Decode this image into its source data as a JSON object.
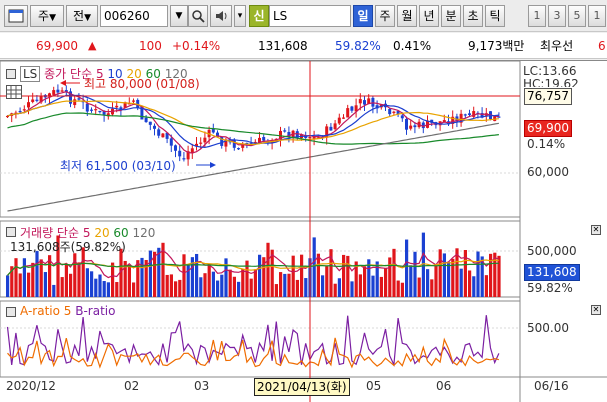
{
  "toolbar": {
    "market_select": "주",
    "market_arrow": "▼",
    "code_label": "전",
    "stock_code": "006260",
    "code_arrow": "▼",
    "shin_label": "신",
    "stock_name": "LS",
    "periods": [
      "일",
      "주",
      "월",
      "년",
      "분",
      "초",
      "틱"
    ],
    "active_period": "일",
    "interval_buttons": [
      "1",
      "3",
      "5",
      "1"
    ],
    "icons": [
      "window-icon",
      "search-icon",
      "speaker-icon",
      "dropdown-icon"
    ]
  },
  "infobar": {
    "price": "69,900",
    "change": "100",
    "change_pct": "+0.14%",
    "volume": "131,608",
    "volume_ratio": "59.82%",
    "turnover": "0.41%",
    "trading_value": "9,173백만",
    "preferred_label": "최우선",
    "preferred_value": "6"
  },
  "price_panel": {
    "series_label": "LS",
    "ma_label": "종가 단순",
    "ma_periods": [
      "5",
      "10",
      "20",
      "60",
      "120"
    ],
    "high_annotation": "최고 80,000 (01/08)",
    "low_annotation": "최저 61,500 (03/10)",
    "lc_label": "LC:13.66",
    "hc_label": "HC:19.62",
    "crosshair_value": "76,757",
    "current_price": "69,900",
    "current_change": "0.14%",
    "y_tick": "60,000"
  },
  "volume_panel": {
    "label": "거래량 단순",
    "ma_periods": [
      "5",
      "20",
      "60",
      "120"
    ],
    "info": "131,608주(59.82%)",
    "y_tick": "500,000",
    "current_volume": "131,608",
    "current_ratio": "59.82%"
  },
  "ratio_panel": {
    "a_label": "A-ratio 5",
    "b_label": "B-ratio",
    "y_tick": "500.00"
  },
  "x_axis": {
    "labels": [
      "2020/12",
      "02",
      "03",
      "05",
      "06"
    ],
    "crosshair_date": "2021/04/13(화)",
    "right_date": "06/16"
  },
  "colors": {
    "up": "#e0161b",
    "down": "#1b41d2",
    "ma5": "#c2185b",
    "ma10": "#1c3fcf",
    "ma20": "#e8a300",
    "ma60": "#198a2b",
    "ma120": "#707070",
    "a_ratio": "#ef6c00",
    "b_ratio": "#7b1fa2",
    "crosshair": "#e0161b"
  }
}
